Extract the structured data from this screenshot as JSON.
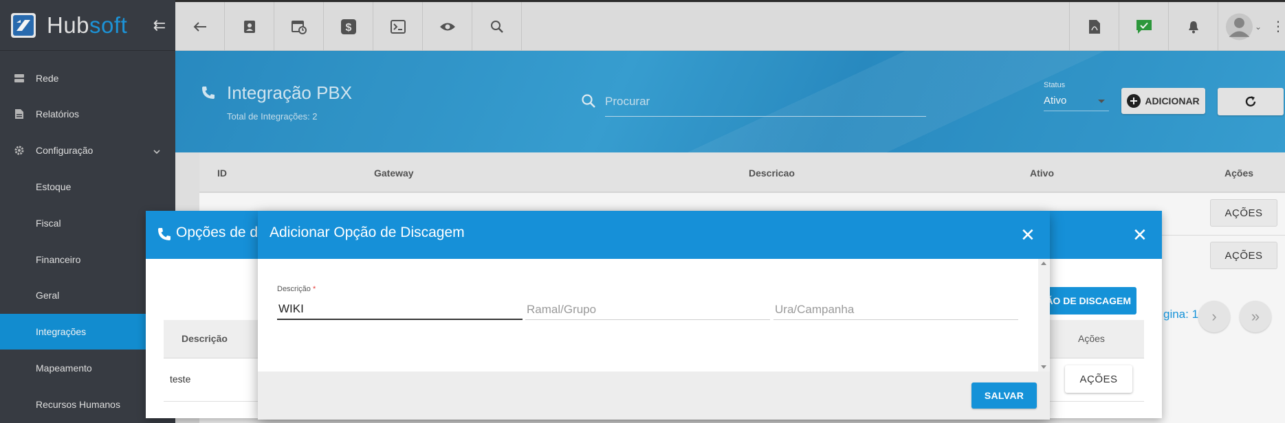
{
  "app": {
    "logo_hub": "Hub",
    "logo_soft": "soft"
  },
  "sidebar": {
    "items": [
      {
        "label": "Rede",
        "icon": "server-icon"
      },
      {
        "label": "Relatórios",
        "icon": "document-icon"
      },
      {
        "label": "Configuração",
        "icon": "gear-icon"
      },
      {
        "label": "Estoque"
      },
      {
        "label": "Fiscal"
      },
      {
        "label": "Financeiro"
      },
      {
        "label": "Geral"
      },
      {
        "label": "Integrações",
        "active": true
      },
      {
        "label": "Mapeamento"
      },
      {
        "label": "Recursos Humanos"
      }
    ]
  },
  "topbar": {
    "left_icons": [
      "back-arrow-icon",
      "contact-card-icon",
      "calendar-clock-icon",
      "dollar-icon",
      "terminal-icon",
      "eye-icon",
      "search-icon"
    ],
    "right_icons": [
      "pdf-icon",
      "chat-check-icon",
      "bell-icon",
      "avatar"
    ]
  },
  "page": {
    "title": "Integração PBX",
    "total_label": "Total de Integrações: 2",
    "search_placeholder": "Procurar",
    "status_caption": "Status",
    "status_value": "Ativo",
    "add_label": "ADICIONAR"
  },
  "table": {
    "columns": [
      "ID",
      "Gateway",
      "Descricao",
      "Ativo",
      "Ações"
    ],
    "row_action_label": "AÇÕES"
  },
  "mid_modal": {
    "title": "Opções de d",
    "add_button_label": "ÃO DE DISCAGEM",
    "pagina_label": "gina: 1",
    "columns": [
      "Descrição",
      "Ações"
    ],
    "rows": [
      {
        "descricao": "teste",
        "acao": "AÇÕES"
      }
    ]
  },
  "front_modal": {
    "title": "Adicionar Opção de Discagem",
    "descricao_label": "Descrição",
    "descricao_required": "*",
    "descricao_value": "WIKI",
    "ramal_placeholder": "Ramal/Grupo",
    "ura_placeholder": "Ura/Campanha",
    "save_label": "SALVAR"
  },
  "colors": {
    "sidebar_bg": "#3a3e45",
    "accent_blue": "#1592d8",
    "topbar_bg": "#e4e4e4"
  }
}
